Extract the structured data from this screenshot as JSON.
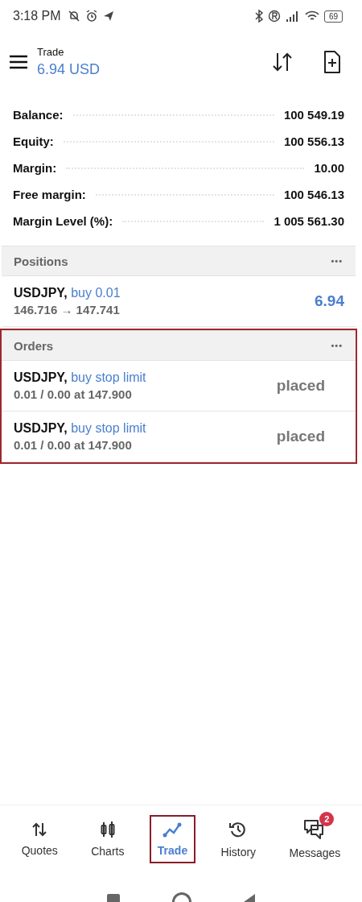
{
  "status_bar": {
    "time": "3:18 PM",
    "battery": "69"
  },
  "header": {
    "title": "Trade",
    "subtitle": "6.94 USD"
  },
  "summary": [
    {
      "label": "Balance:",
      "value": "100 549.19"
    },
    {
      "label": "Equity:",
      "value": "100 556.13"
    },
    {
      "label": "Margin:",
      "value": "10.00"
    },
    {
      "label": "Free margin:",
      "value": "100 546.13"
    },
    {
      "label": "Margin Level (%):",
      "value": "1 005 561.30"
    }
  ],
  "positions": {
    "title": "Positions",
    "menu": "•••",
    "highlighted": false,
    "rows": [
      {
        "symbol": "USDJPY,",
        "action": "buy 0.01",
        "detail": "146.716 → 147.741",
        "result": "6.94",
        "kind": "profit"
      }
    ]
  },
  "orders": {
    "title": "Orders",
    "menu": "•••",
    "highlighted": true,
    "rows": [
      {
        "symbol": "USDJPY,",
        "action": "buy stop limit",
        "detail": "0.01 / 0.00 at 147.900",
        "result": "placed",
        "kind": "status"
      },
      {
        "symbol": "USDJPY,",
        "action": "buy stop limit",
        "detail": "0.01 / 0.00 at 147.900",
        "result": "placed",
        "kind": "status"
      }
    ]
  },
  "tabs": [
    {
      "label": "Quotes",
      "selected": false,
      "highlighted": false
    },
    {
      "label": "Charts",
      "selected": false,
      "highlighted": false
    },
    {
      "label": "Trade",
      "selected": true,
      "highlighted": true
    },
    {
      "label": "History",
      "selected": false,
      "highlighted": false
    },
    {
      "label": "Messages",
      "selected": false,
      "highlighted": false,
      "badge": "2"
    }
  ]
}
